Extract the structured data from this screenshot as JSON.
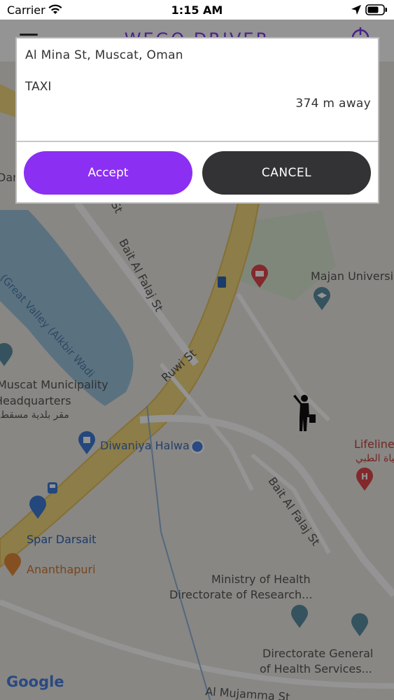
{
  "status_bar": {
    "carrier": "Carrier",
    "time": "1:15 AM"
  },
  "header": {
    "title": "WEGO DRIVER"
  },
  "dialog": {
    "address": "Al Mina St, Muscat, Oman",
    "ride_type": "TAXI",
    "distance": "374 m away",
    "accept_label": "Accept",
    "cancel_label": "CANCEL"
  },
  "map": {
    "labels": {
      "great_valley": "(Great Valley (Alkbir Wadi",
      "bait_al_falaj_1": "Bait Al Falaj St",
      "bait_al_falaj_2": "Bait Al Falaj St",
      "ruwi_st": "Ruwi St",
      "majan": "Majan Universi",
      "muscat_muni_1": "Muscat Municipality",
      "muscat_muni_2": "Headquarters",
      "muscat_muni_ar": "مقر بلدية مسقط",
      "diwaniya": "Diwaniya Halwa",
      "lifeline": "Lifeline",
      "lifeline_ar": "حياة الطبي",
      "spar": "Spar Darsait",
      "ananthapuri": "Ananthapuri",
      "ministry_1": "Ministry of Health",
      "ministry_2": "Directorate of Research...",
      "dg_1": "Directorate General",
      "dg_2": "of Health Services...",
      "al_mujamma": "Al Mujamma St",
      "darsa": "Darsa",
      "al_st": "Al St",
      "google": "Google"
    }
  },
  "colors": {
    "accent": "#8b2ff2",
    "cancel": "#333335"
  }
}
